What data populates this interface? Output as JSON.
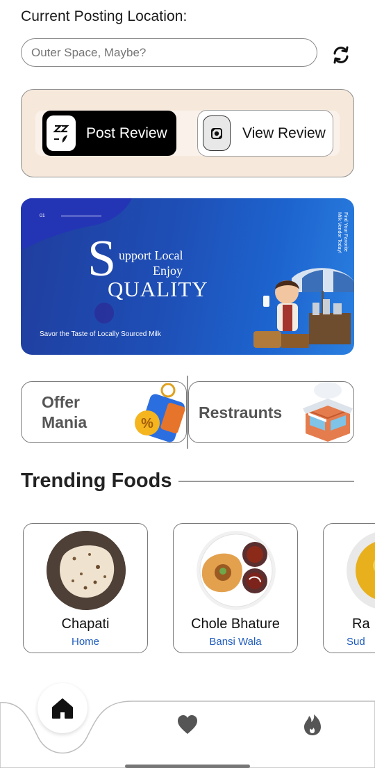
{
  "location": {
    "title": "Current Posting Location:",
    "placeholder": "Outer Space, Maybe?",
    "refresh_icon": "refresh-icon"
  },
  "review_actions": {
    "post_label": "Post Review",
    "view_label": "View Review"
  },
  "banner": {
    "number": "01",
    "big_letter": "S",
    "line1": "upport Local",
    "line2": "Enjoy",
    "line3": "QUALITY",
    "tagline": "Savor the Taste of Locally Sourced Milk",
    "side_text": "Find Your Favorite Milk Vendor Today!"
  },
  "categories": [
    {
      "label_line1": "Offer",
      "label_line2": "Mania"
    },
    {
      "label": "Restraunts"
    }
  ],
  "trending": {
    "title": "Trending Foods",
    "items": [
      {
        "name": "Chapati",
        "vendor": "Home"
      },
      {
        "name": "Chole Bhature",
        "vendor": "Bansi Wala"
      },
      {
        "name": "Ra",
        "vendor": "Sud"
      }
    ]
  },
  "nav": {
    "items": [
      "home-icon",
      "heart-icon",
      "fire-icon"
    ]
  },
  "colors": {
    "review_bg": "#f6e9dc",
    "banner_blue": "#1e4fb6",
    "vendor_link": "#1e5bbd"
  }
}
